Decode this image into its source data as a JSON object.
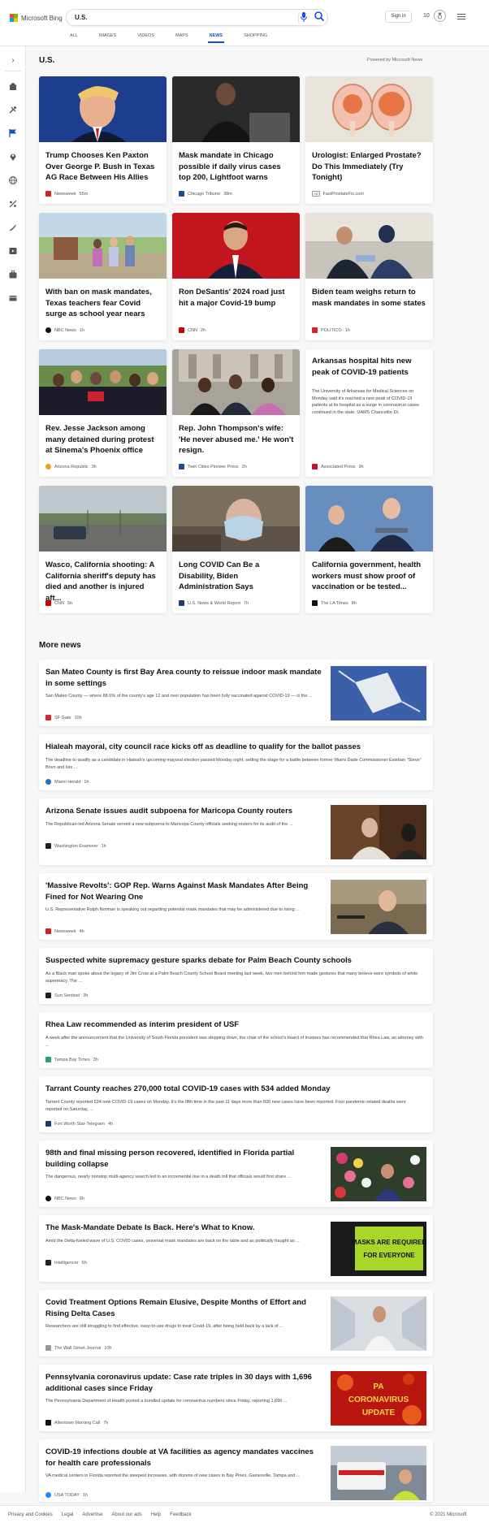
{
  "header": {
    "logo_text": "Microsoft Bing",
    "search_value": "U.S.",
    "signin_label": "Sign in",
    "points": "10",
    "tabs": [
      {
        "label": "ALL"
      },
      {
        "label": "IMAGES"
      },
      {
        "label": "VIDEOS"
      },
      {
        "label": "MAPS"
      },
      {
        "label": "NEWS"
      },
      {
        "label": "SHOPPING"
      }
    ],
    "active_tab": "NEWS",
    "accent_color": "#174ae4"
  },
  "main": {
    "title": "U.S.",
    "powered_by": "Powered by Microsoft News"
  },
  "cards": [
    {
      "title": "Trump Chooses Ken Paxton Over George P. Bush in Texas AG Race Between His Allies",
      "source": "Newsweek",
      "time": "55m"
    },
    {
      "title": "Mask mandate in Chicago possible if daily virus cases top 200, Lightfoot warns",
      "source": "Chicago Tribune",
      "time": "38m"
    },
    {
      "title": "Urologist: Enlarged Prostate? Do This Immediately (Try Tonight)",
      "source": "FastProstateFix.com",
      "ad": "Ad"
    },
    {
      "title": "With ban on mask mandates, Texas teachers fear Covid surge as school year nears",
      "source": "NBC News",
      "time": "1h"
    },
    {
      "title": "Ron DeSantis' 2024 road just hit a major Covid-19 bump",
      "source": "CNN",
      "time": "2h"
    },
    {
      "title": "Biden team weighs return to mask mandates in some states",
      "source": "POLITICO",
      "time": "1h"
    },
    {
      "title": "Rev. Jesse Jackson among many detained during protest at Sinema's Phoenix office",
      "source": "Arizona Republic",
      "time": "3h"
    },
    {
      "title": "Rep. John Thompson's wife: 'He never abused me.' He won't resign.",
      "source": "Twin Cities Pioneer Press",
      "time": "2h"
    },
    {
      "title": "Arkansas hospital hits new peak of COVID-19 patients",
      "body": "The University of Arkansas for Medical Sciences on Monday said it's reached a new peak of COVID-19 patients at its hospital as a surge in coronavirus cases continued in the state. UAMS Chancellor Dr.",
      "source": "Associated Press",
      "time": "9h"
    },
    {
      "title": "Wasco, California shooting: A California sheriff's deputy has died and another is injured aft...",
      "source": "CNN",
      "time": "5h"
    },
    {
      "title": "Long COVID Can Be a Disability, Biden Administration Says",
      "source": "U.S. News & World Report",
      "time": "7h"
    },
    {
      "title": "California government, health workers must show proof of vaccination or be tested...",
      "source": "The LA Times",
      "time": "8h"
    }
  ],
  "more_news": {
    "title": "More news",
    "items": [
      {
        "title": "San Mateo County is first Bay Area county to reissue indoor mask mandate in some settings",
        "body": "San Mateo County — where 88.6% of the county's age 12 and over population has been fully vaccinated against COVID-19 — is the ...",
        "source": "SF Gate",
        "time": "10h"
      },
      {
        "title": "Hialeah mayoral, city council race kicks off as deadline to qualify for the ballot passes",
        "body": "The deadline to qualify as a candidate in Hialeah's upcoming mayoral election passed Monday night, setting the stage for a battle between former Miami Dade Commissioner Esteban \"Steve\" Bovo and Isis ...",
        "source": "Miami Herald",
        "time": "1h"
      },
      {
        "title": "Arizona Senate issues audit subpoena for Maricopa County routers",
        "body": "The Republican-led Arizona Senate served a new subpoena to Maricopa County officials seeking routers for its audit of the ...",
        "source": "Washington Examiner",
        "time": "1h"
      },
      {
        "title": "'Massive Revolts': GOP Rep. Warns Against Mask Mandates After Being Fined for Not Wearing One",
        "body": "U.S. Representative Ralph Norman is speaking out regarding potential mask mandates that may be administered due to rising ...",
        "source": "Newsweek",
        "time": "4h"
      },
      {
        "title": "Suspected white supremacy gesture sparks debate for Palm Beach County schools",
        "body": "As a Black man spoke about the legacy of Jim Crow at a Palm Beach County School Board meeting last week, two men behind him made gestures that many believe were symbols of white supremacy. The ...",
        "source": "Sun Sentinel",
        "time": "3h"
      },
      {
        "title": "Rhea Law recommended as interim president of USF",
        "body": "A week after the announcement that the University of South Florida president was stepping down, the chair of the school's board of trustees has recommended that Rhea Law, an attorney with ...",
        "source": "Tampa Bay Times",
        "time": "3h"
      },
      {
        "title": "Tarrant County reaches 270,000 total COVID-19 cases with 534 added Monday",
        "body": "Tarrant County reported 534 new COVID-19 cases on Monday. It's the fifth time in the past 11 days more than 500 new cases have been reported. Four pandemic-related deaths were reported on Saturday, ...",
        "source": "Fort Worth Star-Telegram",
        "time": "4h"
      },
      {
        "title": "98th and final missing person recovered, identified in Florida partial building collapse",
        "body": "The dangerous, nearly nonstop multi-agency search led to an incremental rise in a death toll that officials would first share ...",
        "source": "NBC News",
        "time": "6h"
      },
      {
        "title": "The Mask-Mandate Debate Is Back. Here's What to Know.",
        "body": "Amid the Delta-fueled wave of U.S. COVID cases, universal mask mandates are back on the table and as politically fraught as ...",
        "source": "Intelligencer",
        "time": "6h",
        "img_text_1": "MASKS ARE REQUIRED",
        "img_text_2": "FOR EVERYONE"
      },
      {
        "title": "Covid Treatment Options Remain Elusive, Despite Months of Effort and Rising Delta Cases",
        "body": "Researchers are still struggling to find effective, easy-to-use drugs to treat Covid-19, after being held back by a lack of ...",
        "source": "The Wall Street Journal",
        "time": "10h"
      },
      {
        "title": "Pennsylvania coronavirus update: Case rate triples in 30 days with 1,696 additional cases since Friday",
        "body": "The Pennsylvania Department of Health posted a bundled update for coronavirus numbers since Friday, reporting 1,696 ...",
        "source": "Allentown Morning Call",
        "time": "7h",
        "img_text_1": "PA",
        "img_text_2": "CORONAVIRUS",
        "img_text_3": "UPDATE"
      },
      {
        "title": "COVID-19 infections double at VA facilities as agency mandates vaccines for health care professionals",
        "body": "VA medical centers in Florida reported the steepest increases, with dozens of new cases in Bay Pines, Gainesville, Tampa and ...",
        "source": "USA TODAY",
        "time": "1h"
      }
    ]
  },
  "footer": {
    "links": [
      "Privacy and Cookies",
      "Legal",
      "Advertise",
      "About our ads",
      "Help",
      "Feedback"
    ],
    "copyright": "© 2021 Microsoft"
  }
}
